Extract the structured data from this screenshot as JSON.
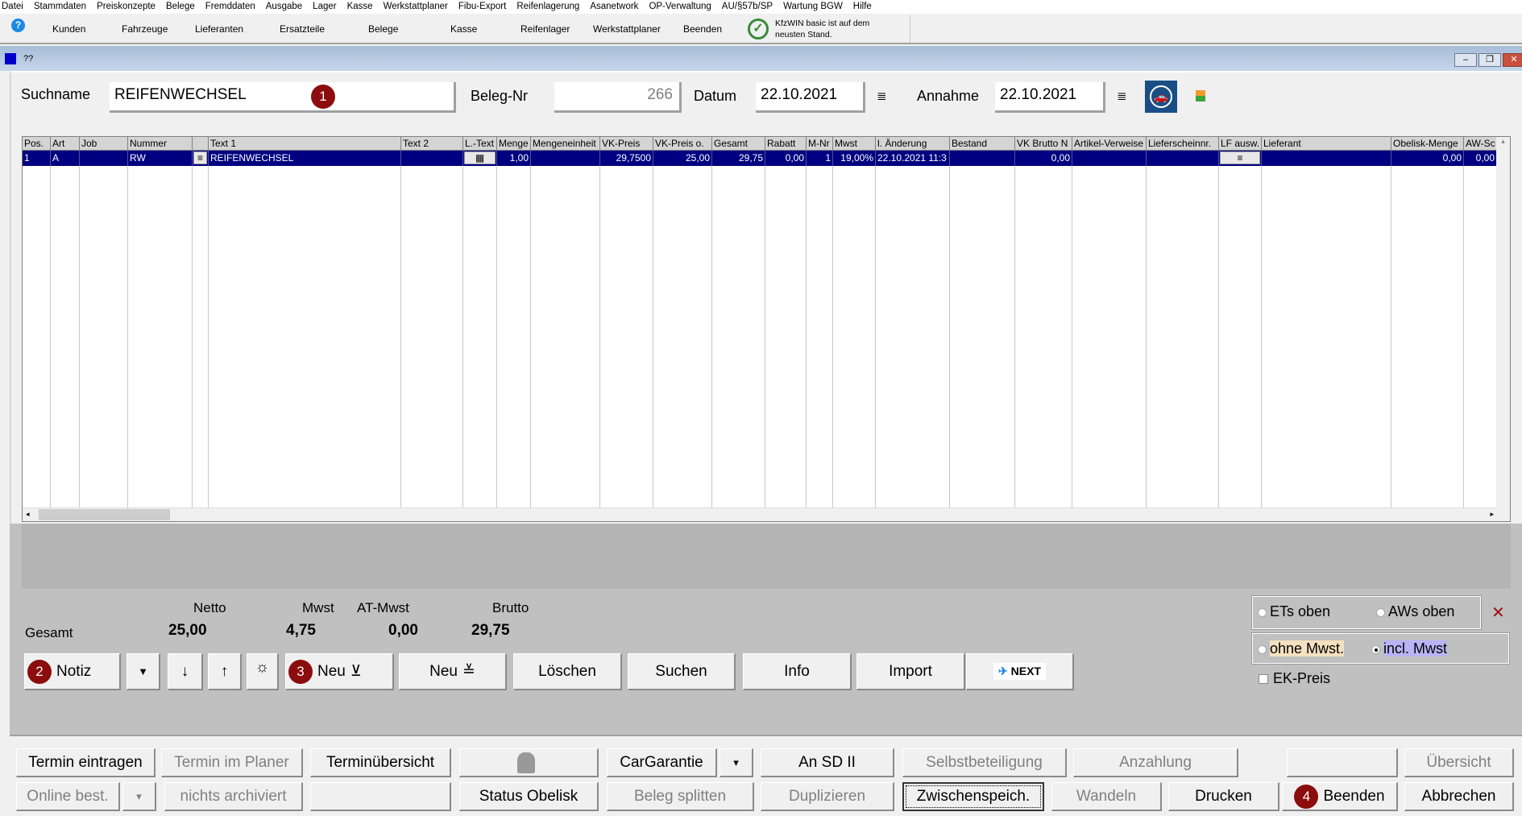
{
  "menu": [
    "Datei",
    "Stammdaten",
    "Preiskonzepte",
    "Belege",
    "Fremddaten",
    "Ausgabe",
    "Lager",
    "Kasse",
    "Werkstattplaner",
    "Fibu-Export",
    "Reifenlagerung",
    "Asanetwork",
    "OP-Verwaltung",
    "AU/§57b/SP",
    "Wartung BGW",
    "Hilfe"
  ],
  "toolbar": {
    "items": [
      "Kunden",
      "Fahrzeuge",
      "Lieferanten",
      "Ersatzteile",
      "Belege",
      "Kasse",
      "Reifenlager",
      "Werkstattplaner",
      "Beenden"
    ],
    "update_status": "KfzWIN basic ist auf dem neusten Stand.",
    "help_icon": "help-icon",
    "status_icon": "check-circle-icon"
  },
  "window": {
    "title": "??"
  },
  "search": {
    "suchname_label": "Suchname",
    "suchname_value": "REIFENWECHSEL",
    "badge1": "1",
    "belegnr_label": "Beleg-Nr",
    "belegnr_value": "266",
    "datum_label": "Datum",
    "datum_value": "22.10.2021",
    "annahme_label": "Annahme",
    "annahme_value": "22.10.2021"
  },
  "grid": {
    "columns": [
      "Pos.",
      "Art",
      "Job",
      "Nummer",
      "",
      "Text 1",
      "Text 2",
      "L.-Text",
      "Menge",
      "Mengeneinheit",
      "VK-Preis",
      "VK-Preis o.",
      "Gesamt",
      "Rabatt",
      "M-Nr",
      "Mwst",
      "l. Änderung",
      "Bestand",
      "VK Brutto N",
      "Artikel-Verweise",
      "Lieferscheinnr.",
      "LF ausw.",
      "Lieferant",
      "Obelisk-Menge",
      "AW-Sc"
    ],
    "rows": [
      [
        "1",
        "A",
        "",
        "RW",
        "≡",
        "REIFENWECHSEL",
        "",
        "▦",
        "1,00",
        "",
        "29,7500",
        "25,00",
        "29,75",
        "0,00",
        "1",
        "19,00%",
        "22.10.2021 11:3",
        "",
        "0,00",
        "",
        "",
        "≡",
        "",
        "0,00",
        "0,00"
      ]
    ]
  },
  "totals": {
    "netto_label": "Netto",
    "mwst_label": "Mwst",
    "atmwst_label": "AT-Mwst",
    "brutto_label": "Brutto",
    "gesamt_label": "Gesamt",
    "netto": "25,00",
    "mwst": "4,75",
    "atmwst": "0,00",
    "brutto": "29,75"
  },
  "actions": {
    "notiz": "Notiz",
    "badge2": "2",
    "neu1": "Neu",
    "badge3": "3",
    "neu2": "Neu",
    "loeschen": "Löschen",
    "suchen": "Suchen",
    "info": "Info",
    "import": "Import",
    "next": "NEXT"
  },
  "options": {
    "ets_oben": "ETs oben",
    "aws_oben": "AWs oben",
    "ohne_mwst": "ohne Mwst.",
    "incl_mwst": "incl. Mwst",
    "incl_selected": true,
    "ek_preis": "EK-Preis",
    "ek_checked": false,
    "highlight_ohne": "#f5e1bf",
    "highlight_incl": "#b9b4f5"
  },
  "bottom": {
    "row1": [
      {
        "label": "Termin eintragen",
        "enabled": true
      },
      {
        "label": "Termin im Planer",
        "enabled": false
      },
      {
        "label": "Terminübersicht",
        "enabled": true
      },
      {
        "label": "",
        "icon": "obelisk-icon",
        "enabled": false
      },
      {
        "label": "CarGarantie",
        "enabled": true
      },
      {
        "label": "▾",
        "enabled": true
      },
      {
        "label": "An SD II",
        "enabled": true
      },
      {
        "label": "Selbstbeteiligung",
        "enabled": false
      },
      {
        "label": "Anzahlung",
        "enabled": false
      },
      {
        "label": "",
        "enabled": false
      },
      {
        "label": "Übersicht",
        "enabled": false
      }
    ],
    "row2": [
      {
        "label": "Online best.",
        "enabled": false
      },
      {
        "label": "▾",
        "enabled": false
      },
      {
        "label": "nichts archiviert",
        "enabled": false
      },
      {
        "label": "",
        "enabled": false
      },
      {
        "label": "Status Obelisk",
        "enabled": true
      },
      {
        "label": "Beleg splitten",
        "enabled": false
      },
      {
        "label": "Duplizieren",
        "enabled": false
      },
      {
        "label": "Zwischenspeich.",
        "enabled": true,
        "focused": true
      },
      {
        "label": "Wandeln",
        "enabled": false
      },
      {
        "label": "Drucken",
        "enabled": true
      },
      {
        "label": "Beenden",
        "enabled": true,
        "badge": "4"
      },
      {
        "label": "Abbrechen",
        "enabled": true
      }
    ]
  },
  "colors": {
    "selection": "#000080",
    "badge": "#8b0d0d",
    "panel_gray": "#c0c0c0"
  }
}
